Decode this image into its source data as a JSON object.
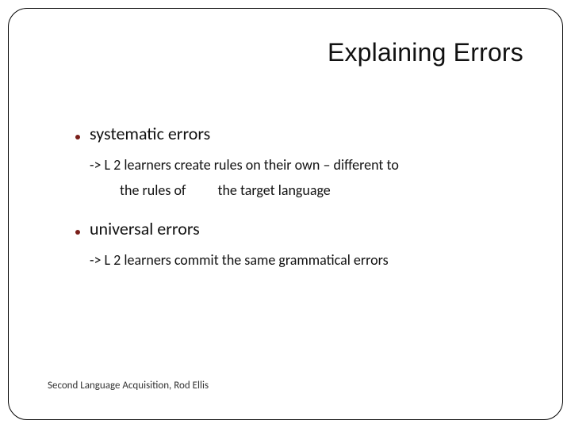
{
  "title": "Explaining Errors",
  "bullets": [
    {
      "heading": "systematic errors",
      "sub_line1": "-> L 2 learners create rules on their own – different to",
      "sub_line2a": "the rules of",
      "sub_line2b": "the target language"
    },
    {
      "heading": "universal errors",
      "sub_line1": "-> L 2 learners commit the same grammatical errors",
      "sub_line2a": "",
      "sub_line2b": ""
    }
  ],
  "footer": "Second Language Acquisition, Rod Ellis"
}
